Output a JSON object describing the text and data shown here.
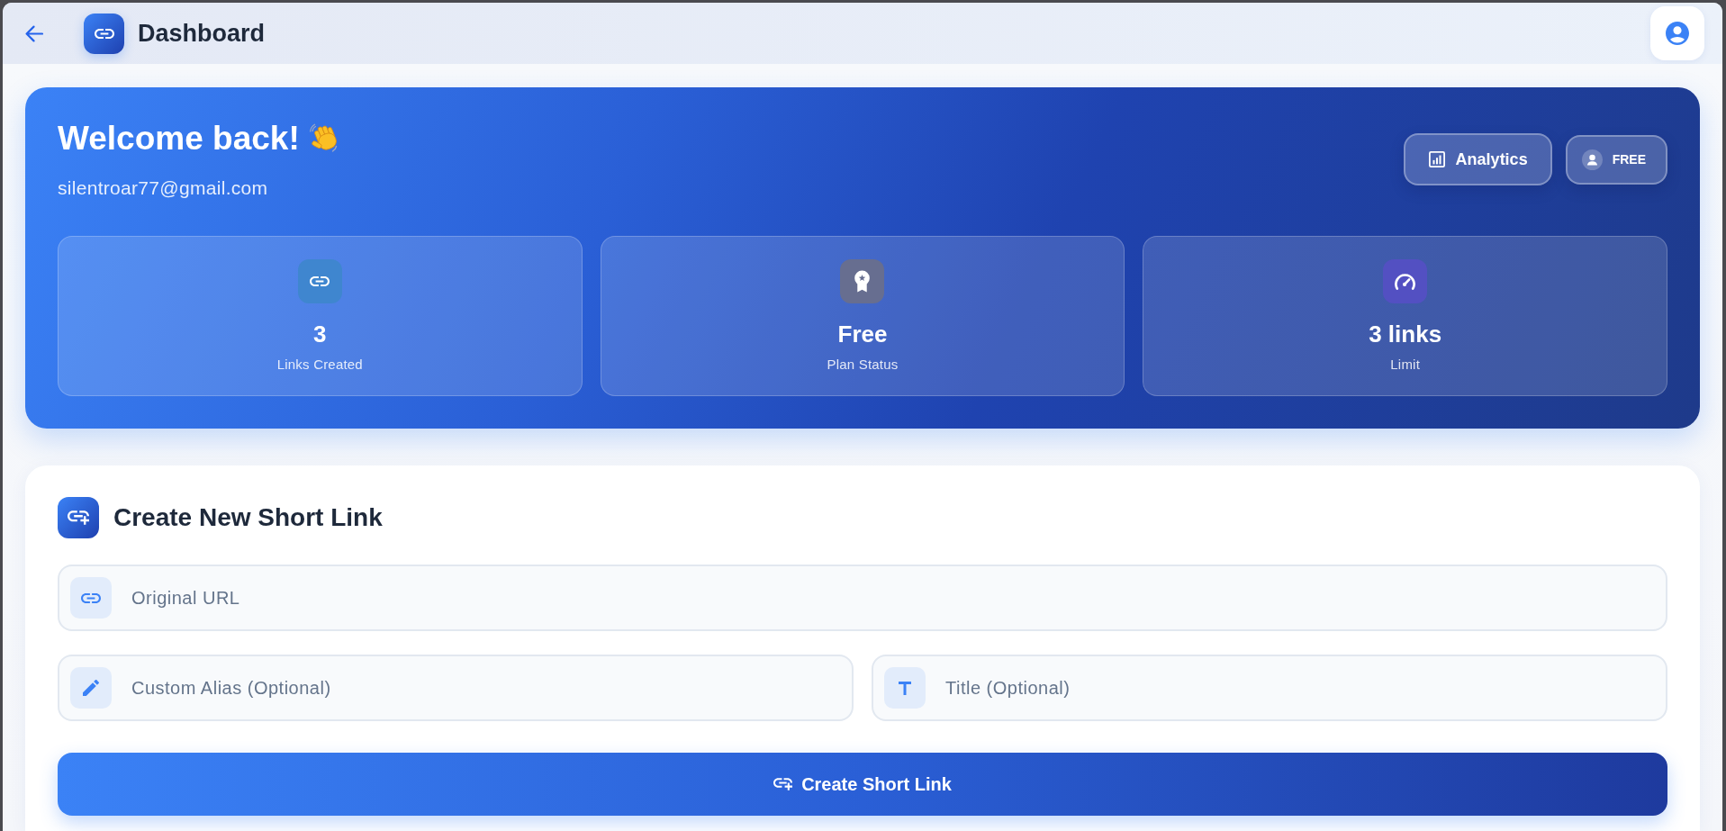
{
  "top_bar": {
    "title": "Dashboard"
  },
  "hero": {
    "greeting": "Welcome back!",
    "email": "silentroar77@gmail.com",
    "analytics_button": {
      "label": "Analytics"
    },
    "plan_button": {
      "label": "FREE"
    },
    "stats": [
      {
        "value": "3",
        "label": "Links Created",
        "color": "#3f86cf"
      },
      {
        "value": "Free",
        "label": "Plan Status",
        "color": "#676e90"
      },
      {
        "value": "3 links",
        "label": "Limit",
        "color": "#5350c2"
      }
    ]
  },
  "create_form": {
    "title": "Create New Short Link",
    "fields": [
      {
        "placeholder": "Original URL"
      },
      {
        "placeholder": "Custom Alias (Optional)"
      },
      {
        "placeholder": "Title (Optional)"
      }
    ],
    "submit": {
      "label": "Create Short Link"
    }
  }
}
